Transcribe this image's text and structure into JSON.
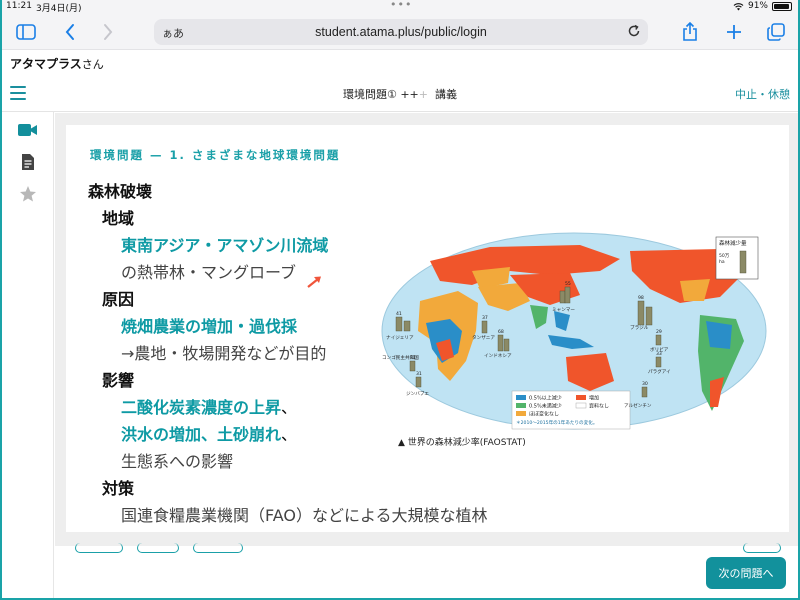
{
  "status": {
    "time": "11:21",
    "date": "3月4日(月)",
    "battery": "91%",
    "battery_level": 0.91
  },
  "browser": {
    "aa": "ぁあ",
    "url": "student.atama.plus/public/login"
  },
  "page_title": {
    "name": "アタマプラス",
    "suffix": "さん"
  },
  "header": {
    "lesson_title": "環境問題① ++",
    "lesson_title_dim": "+",
    "lesson_kind": "講義",
    "pause_label": "中止・休憩"
  },
  "slide": {
    "section_title": "環境問題 — 1. さまざまな地球環境問題",
    "heading": "森林破壊",
    "region_label": "地域",
    "region_l1": "東南アジア・アマゾン川流域",
    "region_l2": "の熱帯林・マングローブ",
    "cause_label": "原因",
    "cause_l1": "焼畑農業の増加・過伐採",
    "cause_l2": "→農地・牧場開発などが目的",
    "effect_label": "影響",
    "effect_l1a": "二酸化炭素濃度の上昇",
    "effect_l1b": "、",
    "effect_l2a": "洪水の増加、土砂崩れ",
    "effect_l2b": "、",
    "effect_l3": "生態系への影響",
    "measure_label": "対策",
    "measure_l1": "国連食糧農業機関（FAO）などによる大規模な植林"
  },
  "map": {
    "caption": "▲ 世界の森林減少率(FAOSTAT)",
    "legend_box_title": "森林減少量",
    "legend_box_value": "50万",
    "legend_box_unit": "ha",
    "legend": [
      {
        "label": "0.5%以上減少",
        "color": "#2a8ec8"
      },
      {
        "label": "増加",
        "color": "#f0552b"
      },
      {
        "label": "0.5%未満減少",
        "color": "#52b46a"
      },
      {
        "label": "資料なし",
        "color": "#ffffff"
      },
      {
        "label": "ほぼ変化なし",
        "color": "#f2a93b"
      }
    ],
    "legend_note": "＊2010～2015年の1年あたりの変化。",
    "countries": [
      "ナイジェリア",
      "ミャンマー",
      "ブラジル",
      "ボリビア",
      "パラグアイ",
      "アルゼンチン",
      "タンザニア",
      "インドネシア",
      "コンゴ民主共和国",
      "ジンバブエ"
    ],
    "values": [
      "41",
      "55",
      "98",
      "29",
      "33",
      "30",
      "37",
      "68",
      "31",
      "31"
    ]
  },
  "footer": {
    "next_label": "次の問題へ"
  },
  "colors": {
    "teal": "#1aa0a8",
    "button": "#12919c"
  }
}
